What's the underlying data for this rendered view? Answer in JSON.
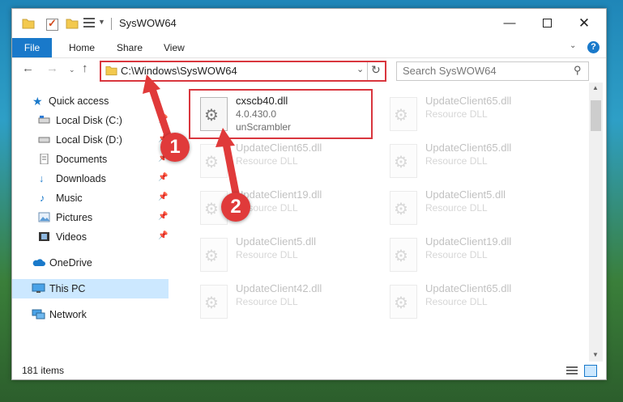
{
  "window": {
    "title": "SysWOW64"
  },
  "ribbon": {
    "tabs": [
      "File",
      "Home",
      "Share",
      "View"
    ]
  },
  "address": {
    "path": "C:\\Windows\\SysWOW64"
  },
  "search": {
    "placeholder": "Search SysWOW64"
  },
  "sidebar": {
    "items": [
      {
        "label": "Quick access",
        "icon": "star-icon",
        "pinned": false
      },
      {
        "label": "Local Disk (C:)",
        "icon": "drive-icon",
        "pinned": true
      },
      {
        "label": "Local Disk (D:)",
        "icon": "drive-icon",
        "pinned": true
      },
      {
        "label": "Documents",
        "icon": "documents-icon",
        "pinned": true
      },
      {
        "label": "Downloads",
        "icon": "download-icon",
        "pinned": true
      },
      {
        "label": "Music",
        "icon": "music-icon",
        "pinned": true
      },
      {
        "label": "Pictures",
        "icon": "pictures-icon",
        "pinned": true
      },
      {
        "label": "Videos",
        "icon": "videos-icon",
        "pinned": true
      },
      {
        "label": "OneDrive",
        "icon": "cloud-icon",
        "pinned": false
      },
      {
        "label": "This PC",
        "icon": "computer-icon",
        "pinned": false,
        "selected": true
      },
      {
        "label": "Network",
        "icon": "network-icon",
        "pinned": false
      }
    ]
  },
  "files": [
    {
      "name": "cxscb40.dll",
      "line2": "4.0.430.0",
      "line3": "unScrambler",
      "faded": false,
      "highlighted": true
    },
    {
      "name": "UpdateClient65.dll",
      "line2": "Resource DLL",
      "faded": true
    },
    {
      "name": "UpdateClient65.dll",
      "line2": "Resource DLL",
      "faded": true
    },
    {
      "name": "UpdateClient65.dll",
      "line2": "Resource DLL",
      "faded": true
    },
    {
      "name": "UpdateClient19.dll",
      "line2": "Resource DLL",
      "faded": true
    },
    {
      "name": "UpdateClient5.dll",
      "line2": "Resource DLL",
      "faded": true
    },
    {
      "name": "UpdateClient5.dll",
      "line2": "Resource DLL",
      "faded": true
    },
    {
      "name": "UpdateClient19.dll",
      "line2": "Resource DLL",
      "faded": true
    },
    {
      "name": "UpdateClient42.dll",
      "line2": "Resource DLL",
      "faded": true
    },
    {
      "name": "UpdateClient65.dll",
      "line2": "Resource DLL",
      "faded": true
    }
  ],
  "status": {
    "items": "181 items"
  },
  "callouts": [
    "1",
    "2"
  ],
  "colors": {
    "accent": "#1979ca",
    "highlight": "#d9363e",
    "selection": "#cce8ff"
  }
}
